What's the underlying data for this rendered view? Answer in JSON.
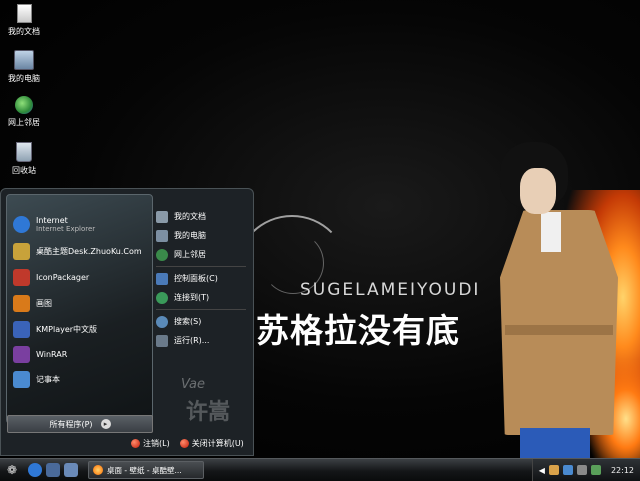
{
  "desktop": {
    "icons": [
      {
        "label": "我的文档",
        "icon": "my-documents-icon"
      },
      {
        "label": "我的电脑",
        "icon": "my-computer-icon"
      },
      {
        "label": "网上邻居",
        "icon": "network-icon"
      },
      {
        "label": "回收站",
        "icon": "recycle-bin-icon"
      }
    ],
    "wallpaper": {
      "latin_text": "SUGELAMEIYOUDI",
      "chinese_text": "苏格拉没有底",
      "logo_text_1": "Vae",
      "logo_text_2": "许嵩"
    }
  },
  "start_menu": {
    "left_items": [
      {
        "label": "Internet",
        "sublabel": "Internet Explorer",
        "icon": "internet-explorer-icon",
        "color": "#2f78d6"
      },
      {
        "label": "桌酷主题Desk.ZhuoKu.Com",
        "icon": "zhuoku-theme-icon",
        "color": "#c8a23a"
      },
      {
        "label": "IconPackager",
        "icon": "iconpackager-icon",
        "color": "#c0392b"
      },
      {
        "label": "画图",
        "icon": "paint-icon",
        "color": "#d97a1a"
      },
      {
        "label": "KMPlayer中文版",
        "icon": "kmplayer-icon",
        "color": "#3a63b8"
      },
      {
        "label": "WinRAR",
        "icon": "winrar-icon",
        "color": "#7a3fa0"
      },
      {
        "label": "记事本",
        "icon": "notepad-icon",
        "color": "#4a8ad0"
      }
    ],
    "all_programs": "所有程序(P)",
    "right_items": [
      {
        "label": "我的文档",
        "icon": "my-documents-icon",
        "color": "#8a9aa8"
      },
      {
        "label": "我的电脑",
        "icon": "my-computer-icon",
        "color": "#7c8fa2"
      },
      {
        "label": "网上邻居",
        "icon": "network-icon",
        "color": "#3a8a4a"
      },
      {
        "label": "控制面板(C)",
        "icon": "control-panel-icon",
        "color": "#4a7ab8"
      },
      {
        "label": "连接到(T)",
        "icon": "connect-to-icon",
        "color": "#3a9a5a"
      },
      {
        "label": "搜索(S)",
        "icon": "search-icon",
        "color": "#5a8ab8"
      },
      {
        "label": "运行(R)...",
        "icon": "run-icon",
        "color": "#6a7a8a"
      }
    ],
    "logoff": "注销(L)",
    "shutdown": "关闭计算机(U)"
  },
  "taskbar": {
    "task_label": "桌面 - 壁纸 - 桌酷壁...",
    "clock": "22:12"
  }
}
